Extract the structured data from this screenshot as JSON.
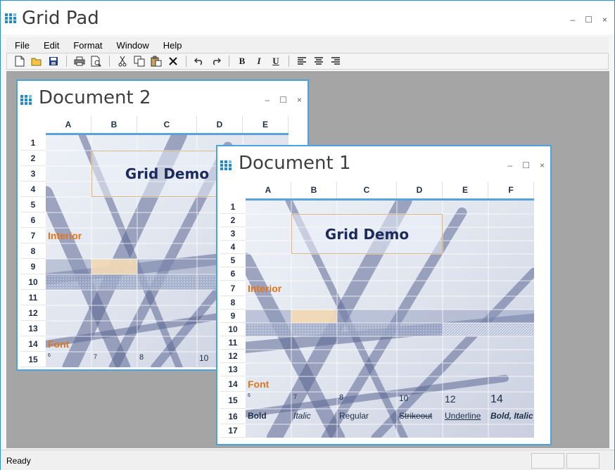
{
  "app": {
    "title": "Grid Pad",
    "window_controls": {
      "minimize": "–",
      "maximize": "☐",
      "close": "×"
    }
  },
  "menu": [
    "File",
    "Edit",
    "Format",
    "Window",
    "Help"
  ],
  "toolbar": {
    "bold": "B",
    "italic": "I",
    "underline": "U"
  },
  "status": {
    "text": "Ready"
  },
  "doc2": {
    "title": "Document 2",
    "columns": [
      "A",
      "B",
      "C",
      "D",
      "E"
    ],
    "rows": [
      "1",
      "2",
      "3",
      "4",
      "5",
      "6",
      "7",
      "8",
      "9",
      "10",
      "11",
      "12",
      "13",
      "14",
      "15"
    ],
    "demo_text": "Grid Demo",
    "interior_label": "Interior",
    "font_label": "Font",
    "size_samples": [
      "6",
      "7",
      "8",
      "10"
    ]
  },
  "doc1": {
    "title": "Document 1",
    "columns": [
      "A",
      "B",
      "C",
      "D",
      "E",
      "F"
    ],
    "rows": [
      "1",
      "2",
      "3",
      "4",
      "5",
      "6",
      "7",
      "8",
      "9",
      "10",
      "11",
      "12",
      "13",
      "14",
      "15",
      "16",
      "17"
    ],
    "demo_text": "Grid Demo",
    "interior_label": "Interior",
    "font_label": "Font",
    "size_samples": [
      "6",
      "7",
      "8",
      "10",
      "12",
      "14"
    ],
    "style_samples": [
      "Bold",
      "Italic",
      "Regular",
      "Strikeout",
      "Underline",
      "Bold, Italic"
    ]
  },
  "colors": {
    "accent": "#4aa3df",
    "mdi_background": "#a5a5a5",
    "label_orange": "#e0751b",
    "header_text": "#1e2d46"
  }
}
